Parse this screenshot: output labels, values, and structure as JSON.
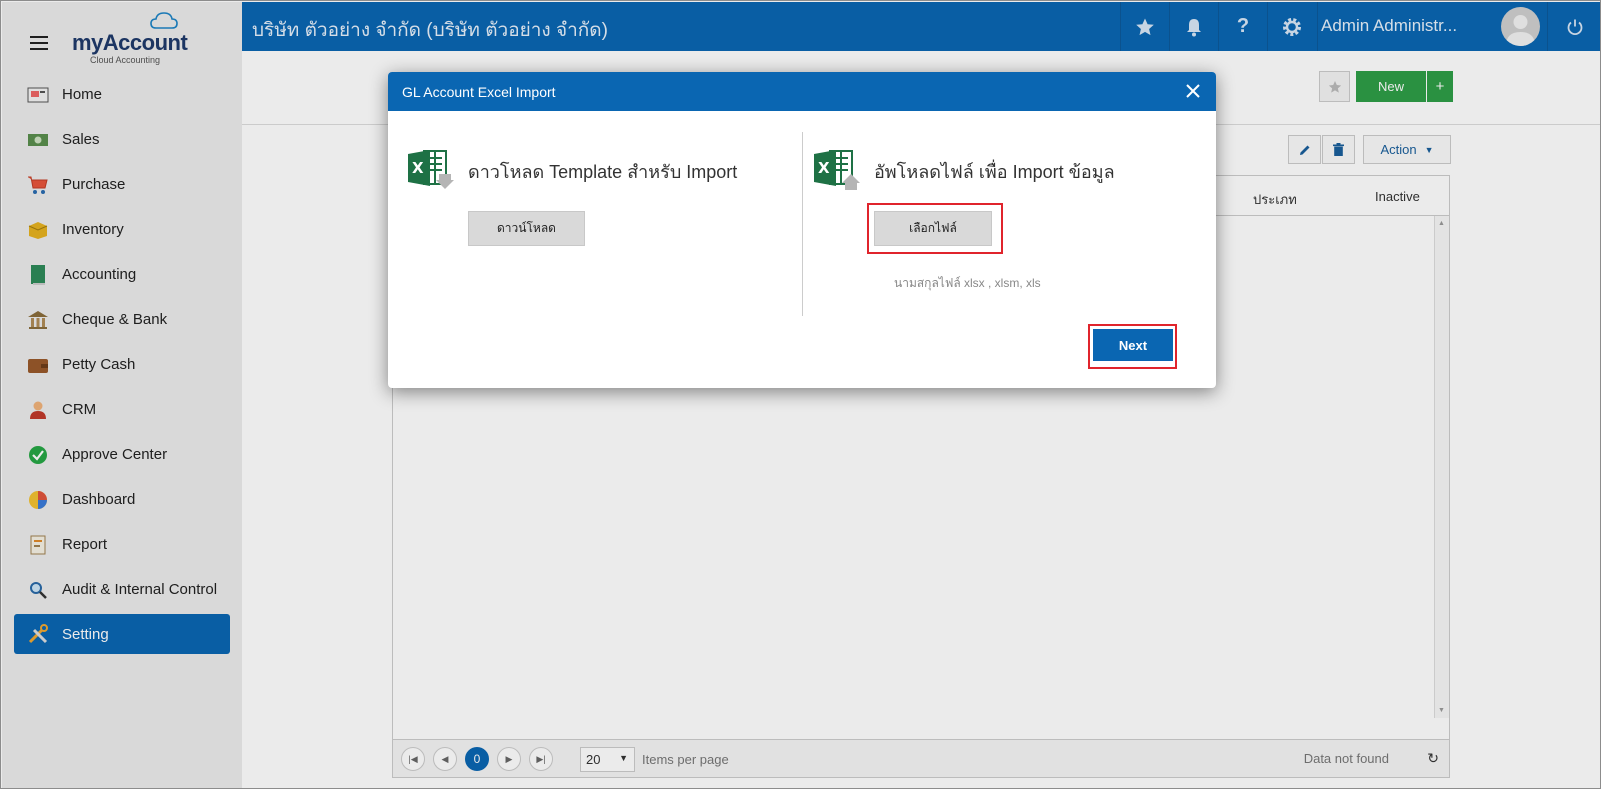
{
  "app": {
    "logo_brand": "myAccount",
    "logo_sub": "Cloud Accounting",
    "company": "บริษัท ตัวอย่าง จำกัด (บริษัท ตัวอย่าง จำกัด)",
    "user": "Admin Administr..."
  },
  "sidebar": {
    "items": [
      {
        "label": "Home",
        "icon": "home-icon"
      },
      {
        "label": "Sales",
        "icon": "sales-icon"
      },
      {
        "label": "Purchase",
        "icon": "cart-icon"
      },
      {
        "label": "Inventory",
        "icon": "box-icon"
      },
      {
        "label": "Accounting",
        "icon": "ledger-icon"
      },
      {
        "label": "Cheque & Bank",
        "icon": "bank-icon"
      },
      {
        "label": "Petty Cash",
        "icon": "wallet-icon"
      },
      {
        "label": "CRM",
        "icon": "person-icon"
      },
      {
        "label": "Approve Center",
        "icon": "check-icon"
      },
      {
        "label": "Dashboard",
        "icon": "pie-icon"
      },
      {
        "label": "Report",
        "icon": "report-icon"
      },
      {
        "label": "Audit & Internal Control",
        "icon": "magnifier-icon"
      },
      {
        "label": "Setting",
        "icon": "tools-icon",
        "active": true
      }
    ]
  },
  "toolbar": {
    "new_label": "New",
    "plus_label": "+",
    "action_label": "Action"
  },
  "grid": {
    "columns": [
      "ประเภท",
      "Inactive"
    ],
    "page_current": "0",
    "page_size": "20",
    "items_per_page": "Items per page",
    "no_data": "Data not found"
  },
  "modal": {
    "title": "GL Account Excel Import",
    "download_title": "ดาวโหลด Template สำหรับ Import",
    "download_button": "ดาวน์โหลด",
    "upload_title": "อัพโหลดไฟล์ เพื่อ Import ข้อมูล",
    "choose_file_button": "เลือกไฟล์",
    "extensions_hint": "นามสกุลไฟล์ xlsx , xlsm, xls",
    "next_button": "Next"
  },
  "colors": {
    "primary": "#0a66b2",
    "success": "#2e9e47",
    "highlight": "#e0242c",
    "sidebar_bg": "#ececec"
  }
}
